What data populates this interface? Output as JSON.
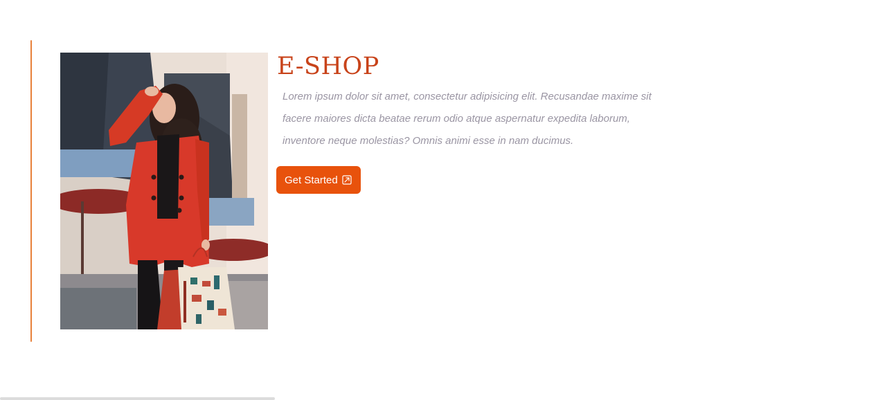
{
  "hero": {
    "title": "E-SHOP",
    "description": "Lorem ipsum dolor sit amet, consectetur adipisicing elit. Recusandae maxime sit facere maiores dicta beatae rerum odio atque aspernatur expedita laborum, inventore neque molestias? Omnis animi esse in nam ducimus.",
    "cta_label": "Get Started",
    "cta_icon": "external-link-icon",
    "image_alt": "woman-in-red-coat-holding-shopping-bags"
  },
  "colors": {
    "accent": "#e8520c",
    "title": "#c8431a",
    "accent_line": "#e8813a",
    "text_muted": "#9a95a3"
  }
}
